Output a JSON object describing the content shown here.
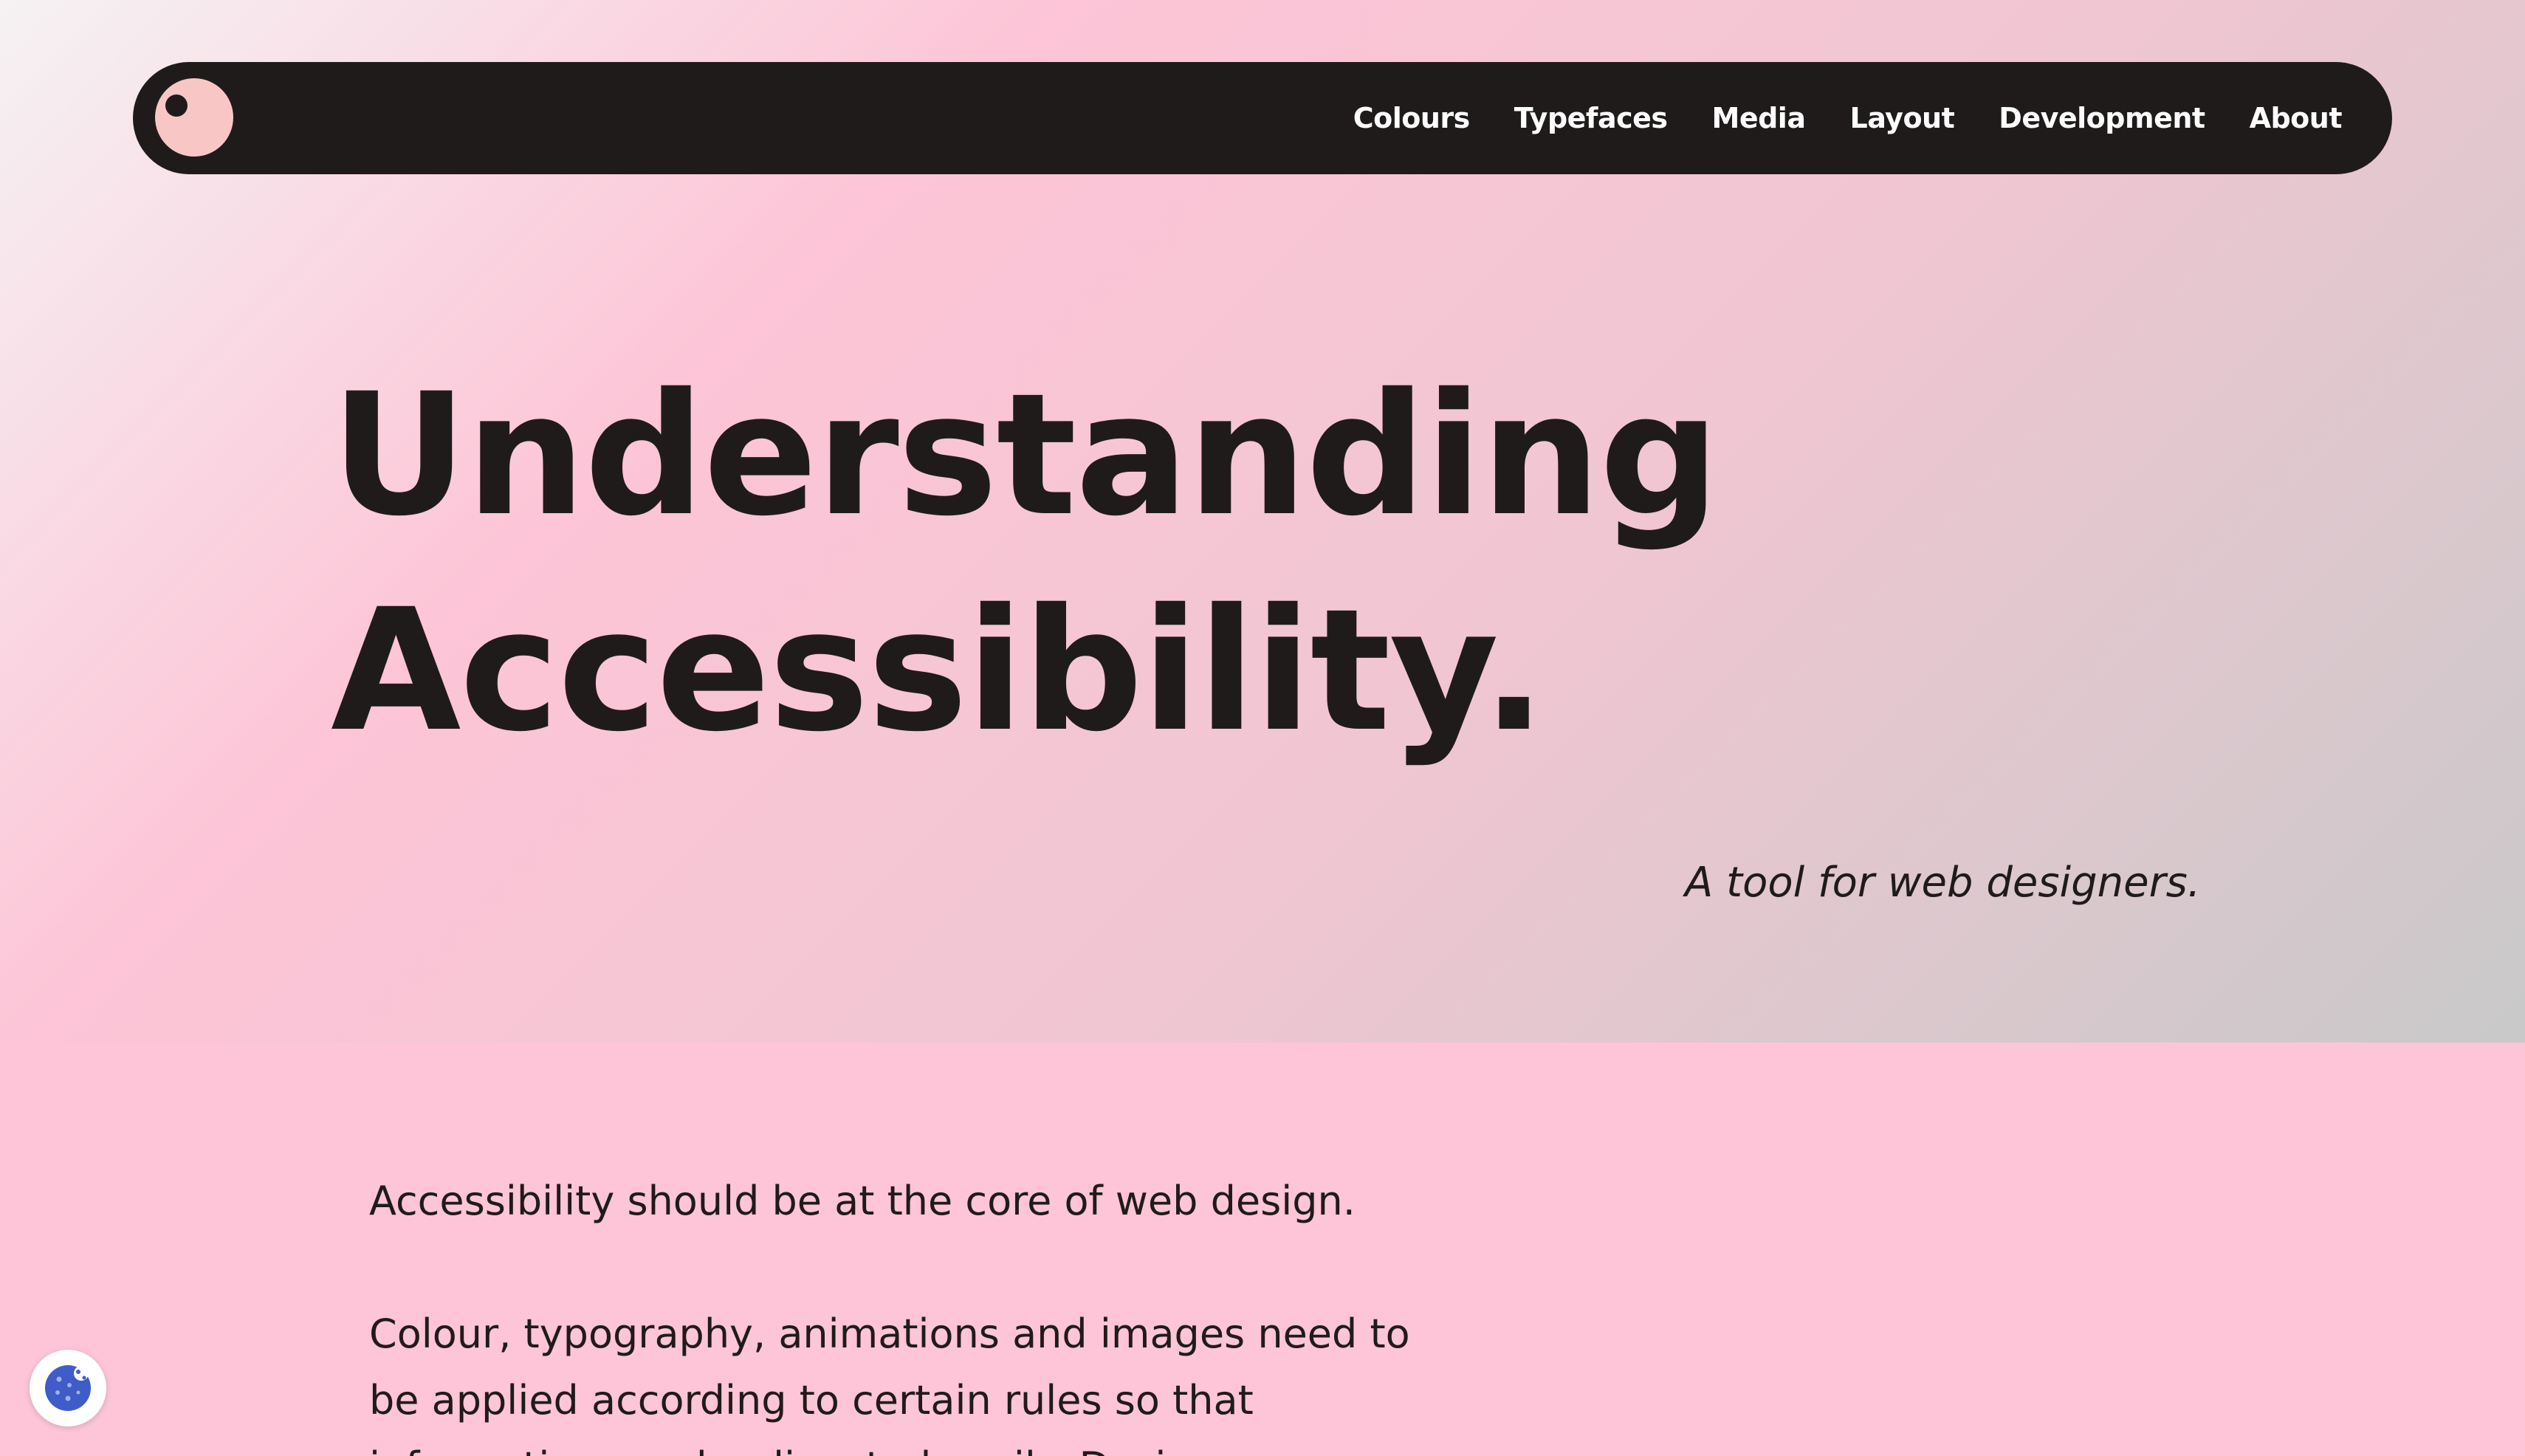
{
  "nav": {
    "logo_icon": "eye-logo-icon",
    "links": [
      {
        "label": "Colours"
      },
      {
        "label": "Typefaces"
      },
      {
        "label": "Media"
      },
      {
        "label": "Layout"
      },
      {
        "label": "Development"
      },
      {
        "label": "About"
      }
    ]
  },
  "hero": {
    "title_line1": "Understanding",
    "title_line2": "Accessibility.",
    "tagline": "A tool for web designers."
  },
  "content": {
    "paragraph1": "Accessibility should be at the core of web design.",
    "paragraph2": "Colour, typography, animations and images need to be applied according to certain rules so that information can be digested easily. Designers"
  },
  "cookie_button": {
    "icon": "cookie-icon"
  },
  "colors": {
    "dark": "#201b1b",
    "pink": "#fdc5d7",
    "logo_pink": "#f9c6c6",
    "cookie_blue": "#3f5cc8"
  }
}
